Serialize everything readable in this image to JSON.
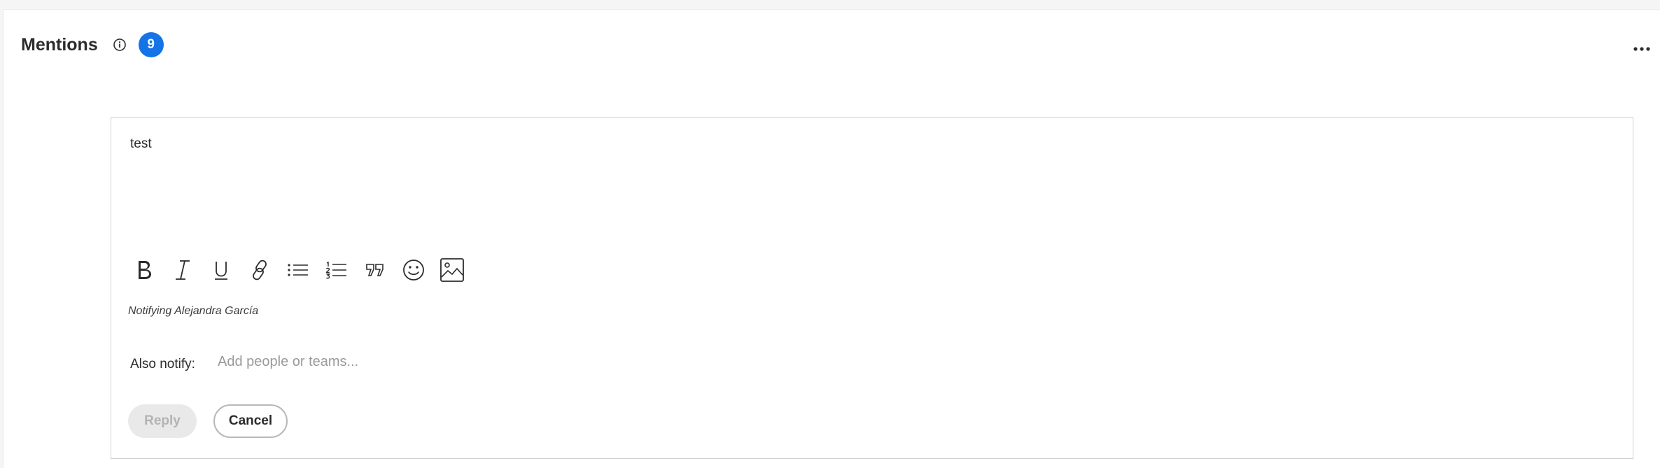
{
  "header": {
    "title": "Mentions",
    "count": "9"
  },
  "icons": {
    "info": "info-icon",
    "more": "more-horizontal-icon",
    "bold": "bold-icon",
    "italic": "italic-icon",
    "underline": "underline-icon",
    "link": "link-icon",
    "bullet_list": "bulleted-list-icon",
    "numbered_list": "numbered-list-icon",
    "quote": "quote-icon",
    "emoji": "emoji-icon",
    "image": "image-icon"
  },
  "editor": {
    "value": "test",
    "notifying": "Notifying Alejandra García",
    "also_notify_label": "Also notify:",
    "also_notify_placeholder": "Add people or teams..."
  },
  "actions": {
    "reply_label": "Reply",
    "cancel_label": "Cancel"
  },
  "colors": {
    "badge": "#1473e6",
    "reply_disabled_bg": "#e9e9e9"
  }
}
